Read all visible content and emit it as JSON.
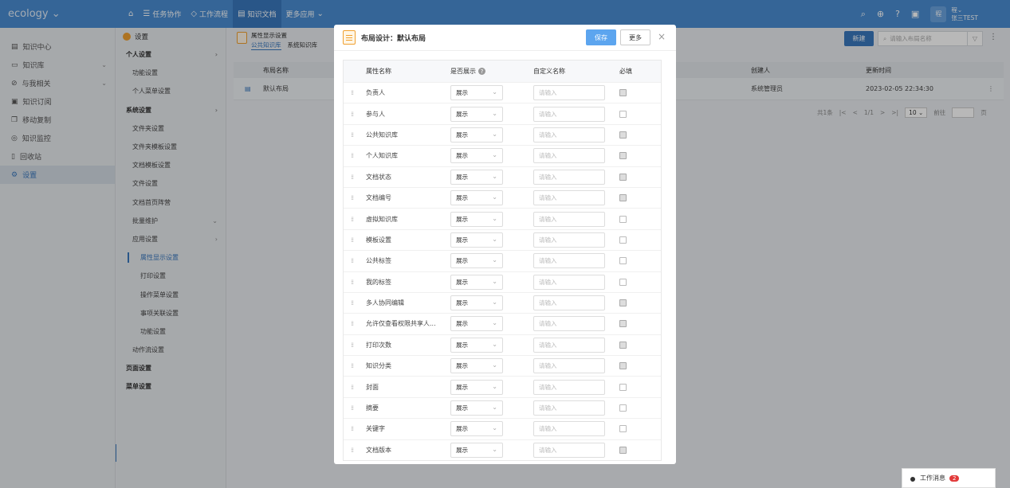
{
  "topbar": {
    "logo": "ecology",
    "nav": [
      {
        "label": "任务协作",
        "icon": "list-icon"
      },
      {
        "label": "工作流程",
        "icon": "flow-icon"
      },
      {
        "label": "知识文档",
        "icon": "doc-icon",
        "active": true
      },
      {
        "label": "更多应用",
        "icon": "chevron-down-icon"
      }
    ],
    "user_avatar": "程",
    "user_name": "张三TEST"
  },
  "left_nav": [
    {
      "label": "知识中心",
      "icon": "doc-icon"
    },
    {
      "label": "知识库",
      "icon": "book-icon",
      "expandable": true
    },
    {
      "label": "与我相关",
      "icon": "link-icon",
      "expandable": true
    },
    {
      "label": "知识订阅",
      "icon": "rss-icon"
    },
    {
      "label": "移动复制",
      "icon": "copy-icon"
    },
    {
      "label": "知识监控",
      "icon": "monitor-icon"
    },
    {
      "label": "回收站",
      "icon": "trash-icon"
    },
    {
      "label": "设置",
      "icon": "gear-icon",
      "active": true
    }
  ],
  "settings": {
    "title": "设置",
    "rows": [
      {
        "label": "个人设置",
        "level": 1,
        "chev": ">"
      },
      {
        "label": "功能设置",
        "level": 2
      },
      {
        "label": "个人菜单设置",
        "level": 2
      },
      {
        "label": "系统设置",
        "level": 1,
        "chev": ">"
      },
      {
        "label": "文件夹设置",
        "level": 2
      },
      {
        "label": "文件夹模板设置",
        "level": 2
      },
      {
        "label": "文档模板设置",
        "level": 2
      },
      {
        "label": "文件设置",
        "level": 2
      },
      {
        "label": "文档首页阵营",
        "level": 2
      },
      {
        "label": "批量维护",
        "level": 2,
        "chev": "v"
      },
      {
        "label": "应用设置",
        "level": 2,
        "chev": ">"
      },
      {
        "label": "属性显示设置",
        "level": 3,
        "selected": true
      },
      {
        "label": "打印设置",
        "level": 3
      },
      {
        "label": "操作菜单设置",
        "level": 3
      },
      {
        "label": "事项关联设置",
        "level": 3
      },
      {
        "label": "功能设置",
        "level": 3
      },
      {
        "label": "动作流设置",
        "level": 2
      },
      {
        "label": "页面设置",
        "level": 1
      },
      {
        "label": "菜单设置",
        "level": 1
      }
    ]
  },
  "main": {
    "page_title": "属性显示设置",
    "tabs": [
      "公共知识库",
      "系统知识库"
    ],
    "new_label": "新建",
    "search_placeholder": "请输入布局名称",
    "columns": {
      "name": "布局名称",
      "creator": "创建人",
      "updated": "更新时间"
    },
    "row": {
      "name": "默认布局",
      "creator": "系统管理员",
      "updated": "2023-02-05 22:34:30"
    },
    "pager": {
      "total": "共1条",
      "pages": "1/1",
      "size": "10",
      "goto": "前往",
      "page_unit": "页"
    }
  },
  "modal": {
    "title": "布局设计：默认布局",
    "save_label": "保存",
    "more_label": "更多",
    "headers": {
      "name": "属性名称",
      "show": "是否展示",
      "custom": "自定义名称",
      "required": "必填"
    },
    "show_value": "展示",
    "input_placeholder": "请输入",
    "rows": [
      {
        "name": "负责人",
        "required_disabled": true
      },
      {
        "name": "参与人",
        "required_disabled": false
      },
      {
        "name": "公共知识库",
        "required_disabled": true
      },
      {
        "name": "个人知识库",
        "required_disabled": true
      },
      {
        "name": "文档状态",
        "required_disabled": true
      },
      {
        "name": "文档编号",
        "required_disabled": true
      },
      {
        "name": "虚拟知识库",
        "required_disabled": false
      },
      {
        "name": "模板设置",
        "required_disabled": false
      },
      {
        "name": "公共标签",
        "required_disabled": false
      },
      {
        "name": "我的标签",
        "required_disabled": false
      },
      {
        "name": "多人协同编辑",
        "required_disabled": true
      },
      {
        "name": "允许仅查看权限共享人...",
        "required_disabled": true
      },
      {
        "name": "打印次数",
        "required_disabled": true
      },
      {
        "name": "知识分类",
        "required_disabled": true
      },
      {
        "name": "封面",
        "required_disabled": false
      },
      {
        "name": "摘要",
        "required_disabled": false
      },
      {
        "name": "关键字",
        "required_disabled": false
      },
      {
        "name": "文档版本",
        "required_disabled": true
      }
    ]
  },
  "message": {
    "label": "工作消息",
    "count": "2"
  }
}
